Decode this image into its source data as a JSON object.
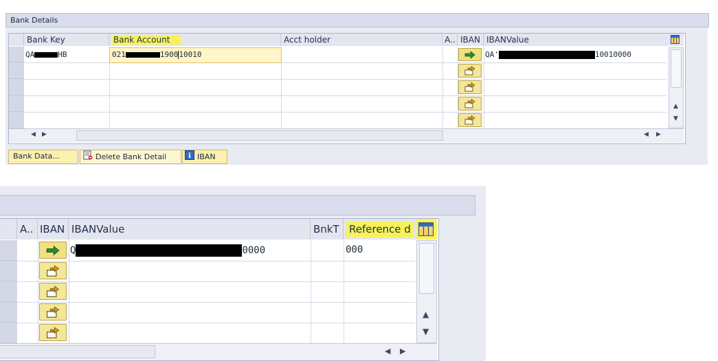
{
  "top_panel": {
    "title": "Bank Details",
    "columns": [
      "Bank Key",
      "Bank Account",
      "Acct holder",
      "A..",
      "IBAN",
      "IBANValue"
    ],
    "row1": {
      "bank_key_start": "QA",
      "bank_key_end": "HB",
      "bank_account_start": "021",
      "bank_account_mid": "1900",
      "bank_account_end": "10010",
      "iban_value_start": "QA'",
      "iban_value_end": "10010000"
    },
    "tabs": [
      "Bank Data...",
      "Delete Bank Detail",
      "IBAN"
    ]
  },
  "bottom_panel": {
    "columns": [
      "A..",
      "IBAN",
      "IBANValue",
      "BnkT",
      "Reference d"
    ],
    "row1": {
      "iban_value_start": "Q",
      "iban_value_end": "0000",
      "reference": "000"
    }
  },
  "colors": {
    "highlight": "#f7f25a",
    "panel": "#e9ebf3",
    "header": "#e4e6ef",
    "button": "#f4e79a"
  },
  "icons": [
    "iban-arrow-icon",
    "column-settings-icon",
    "delete-row-icon",
    "info-icon"
  ]
}
